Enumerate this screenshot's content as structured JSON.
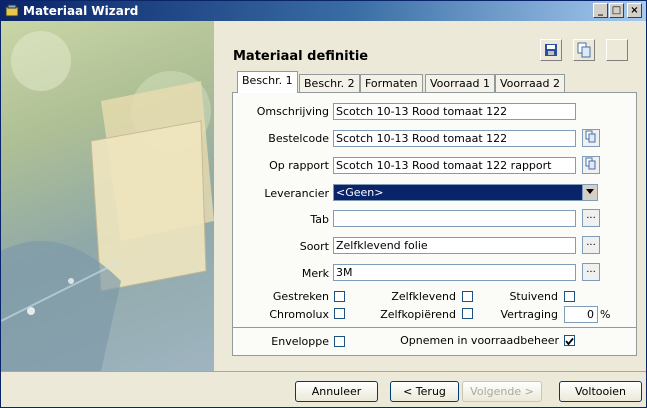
{
  "window": {
    "title": "Materiaal Wizard",
    "minimize": "_",
    "maximize": "□",
    "close": "×"
  },
  "header": {
    "title": "Materiaal definitie"
  },
  "toolbar": {
    "icons": [
      "save-icon",
      "copy-icon",
      "blank-icon"
    ]
  },
  "tabs": [
    {
      "label": "Beschr. 1",
      "active": true
    },
    {
      "label": "Beschr. 2"
    },
    {
      "label": "Formaten"
    },
    {
      "label": "Voorraad 1"
    },
    {
      "label": "Voorraad 2"
    }
  ],
  "form": {
    "omschrijving": {
      "label": "Omschrijving",
      "value": "Scotch 10-13 Rood tomaat 122"
    },
    "bestelcode": {
      "label": "Bestelcode",
      "value": "Scotch 10-13 Rood tomaat 122"
    },
    "op_rapport": {
      "label": "Op rapport",
      "value": "Scotch 10-13 Rood tomaat 122 rapport"
    },
    "leverancier": {
      "label": "Leverancier",
      "value": "<Geen>"
    },
    "tab": {
      "label": "Tab",
      "value": ""
    },
    "soort": {
      "label": "Soort",
      "value": "Zelfklevend folie"
    },
    "merk": {
      "label": "Merk",
      "value": "3M"
    },
    "ellipsis": "..."
  },
  "checks": {
    "gestreken": {
      "label": "Gestreken",
      "checked": false
    },
    "chromolux": {
      "label": "Chromolux",
      "checked": false
    },
    "zelfklevend": {
      "label": "Zelfklevend",
      "checked": false
    },
    "zelfkopierend": {
      "label": "Zelfkopiërend",
      "checked": false
    },
    "stuivend": {
      "label": "Stuivend",
      "checked": false
    },
    "vertraging": {
      "label": "Vertraging",
      "value": "0",
      "unit": "%"
    },
    "enveloppe": {
      "label": "Enveloppe",
      "checked": false
    },
    "opnemen": {
      "label": "Opnemen in voorraadbeheer",
      "checked": true
    }
  },
  "buttons": {
    "annuleer": "Annuleer",
    "terug": "< Terug",
    "volgende": "Volgende >",
    "voltooien": "Voltooien"
  }
}
